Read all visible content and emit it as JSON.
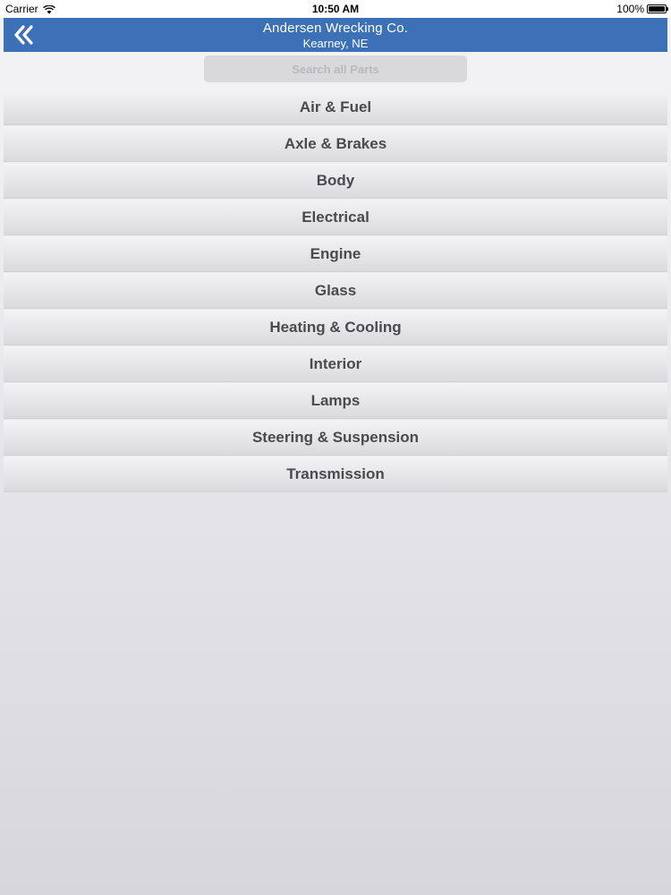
{
  "status_bar": {
    "carrier": "Carrier",
    "time": "10:50 AM",
    "battery": "100%"
  },
  "header": {
    "title": "Andersen Wrecking Co.",
    "subtitle": "Kearney, NE",
    "color": "#3c71b8",
    "back_icon": "double-chevron-left-icon"
  },
  "search": {
    "placeholder": "Search all Parts",
    "value": ""
  },
  "categories": [
    {
      "label": "Air & Fuel"
    },
    {
      "label": "Axle & Brakes"
    },
    {
      "label": "Body"
    },
    {
      "label": "Electrical"
    },
    {
      "label": "Engine"
    },
    {
      "label": "Glass"
    },
    {
      "label": "Heating & Cooling"
    },
    {
      "label": "Interior"
    },
    {
      "label": "Lamps"
    },
    {
      "label": "Steering & Suspension"
    },
    {
      "label": "Transmission"
    }
  ]
}
